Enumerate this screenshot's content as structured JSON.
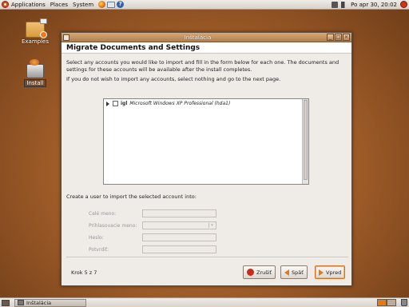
{
  "top_panel": {
    "menus": [
      "Applications",
      "Places",
      "System"
    ],
    "clock": "Po apr 30, 20:02"
  },
  "desktop": {
    "icons": [
      {
        "label": "Examples",
        "icon": "folder-icon"
      },
      {
        "label": "Install",
        "icon": "install-icon"
      }
    ]
  },
  "window": {
    "title": "Inštalácia",
    "page_heading": "Migrate Documents and Settings",
    "intro_line1": "Select any accounts you would like to import and fill in the form below for each one.  The documents and settings for these accounts will be available after the install completes.",
    "intro_line2": "If you do not wish to import any accounts, select nothing and go to the next page.",
    "tree": {
      "items": [
        {
          "label": "Microsoft Windows XP Professional (hda1)",
          "checked": false,
          "icon": "windows-os-icon"
        }
      ]
    },
    "create_user_label": "Create a user to import the selected account into:",
    "form": {
      "full_name_label": "Celé meno:",
      "username_label": "Prihlasovacie meno:",
      "password_label": "Heslo:",
      "confirm_label": "Potvrdiť:"
    },
    "step": "Krok 5 z 7",
    "buttons": {
      "cancel": "Zrušiť",
      "back": "Späť",
      "forward": "Vpred"
    }
  },
  "bottom_panel": {
    "task": "Inštalácia"
  },
  "colors": {
    "accent": "#e07b1c",
    "titlebar": "#b27f4c"
  }
}
